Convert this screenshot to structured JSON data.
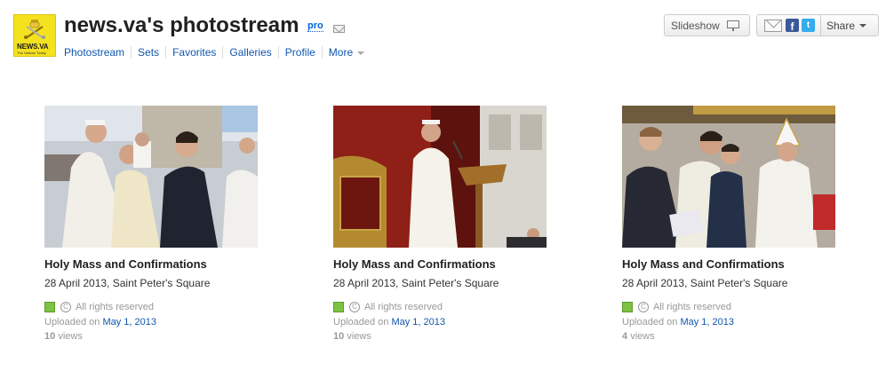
{
  "header": {
    "logo_text": "NEWS.VA",
    "logo_subtext": "The Vatican Today",
    "title": "news.va's photostream",
    "pro_badge": "pro",
    "nav": [
      {
        "label": "Photostream"
      },
      {
        "label": "Sets"
      },
      {
        "label": "Favorites"
      },
      {
        "label": "Galleries"
      },
      {
        "label": "Profile"
      },
      {
        "label": "More"
      }
    ],
    "slideshow_label": "Slideshow",
    "share_label": "Share"
  },
  "photos": [
    {
      "title": "Holy Mass and Confirmations",
      "description": "28 April 2013, Saint Peter's Square",
      "rights": "All rights reserved",
      "uploaded_prefix": "Uploaded on ",
      "uploaded_date": "May 1, 2013",
      "views_count": "10",
      "views_label": "views"
    },
    {
      "title": "Holy Mass and Confirmations",
      "description": "28 April 2013, Saint Peter's Square",
      "rights": "All rights reserved",
      "uploaded_prefix": "Uploaded on ",
      "uploaded_date": "May 1, 2013",
      "views_count": "10",
      "views_label": "views"
    },
    {
      "title": "Holy Mass and Confirmations",
      "description": "28 April 2013, Saint Peter's Square",
      "rights": "All rights reserved",
      "uploaded_prefix": "Uploaded on ",
      "uploaded_date": "May 1, 2013",
      "views_count": "4",
      "views_label": "views"
    }
  ],
  "colors": {
    "link": "#1057ae",
    "pro": "#0063dc",
    "logo_bg": "#f5e21f",
    "license_green": "#7dc242"
  }
}
